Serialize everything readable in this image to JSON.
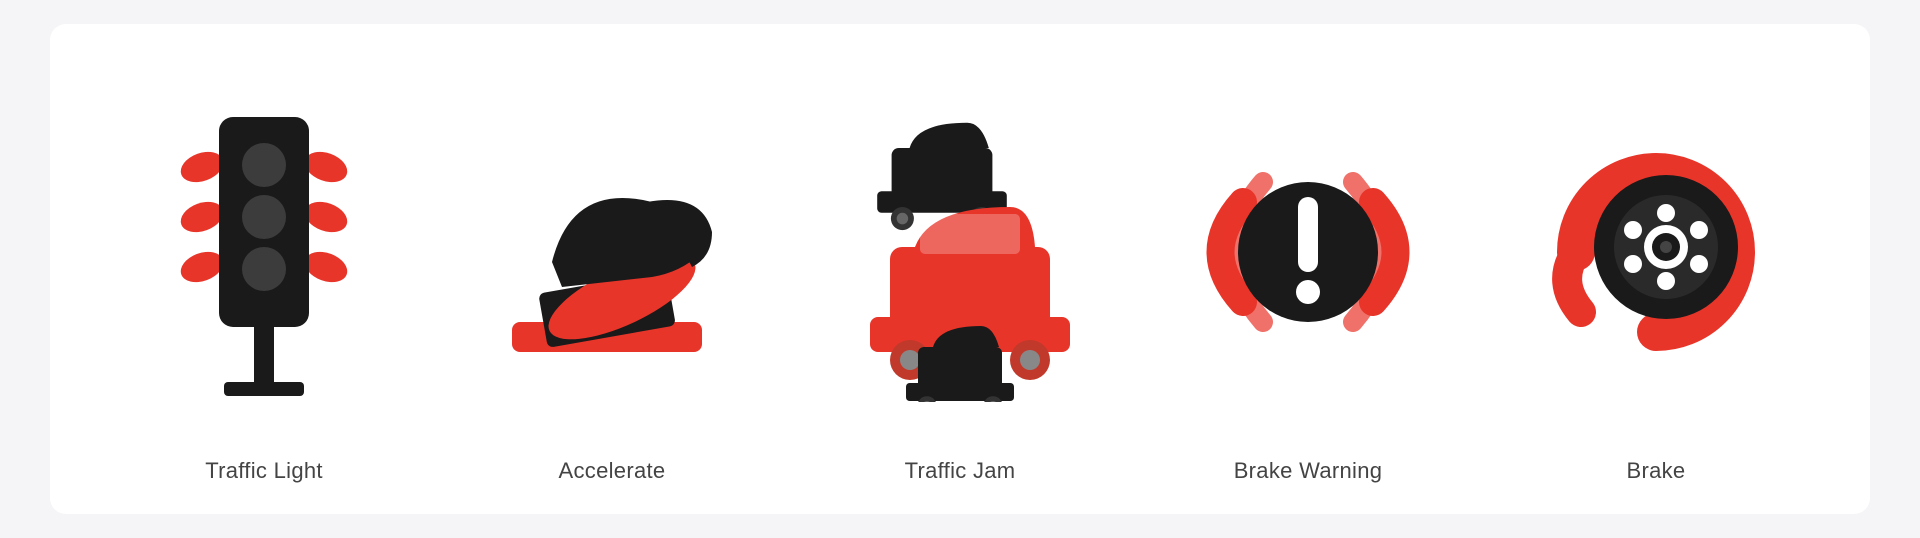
{
  "icons": [
    {
      "id": "traffic-light",
      "label": "Traffic Light"
    },
    {
      "id": "accelerate",
      "label": "Accelerate"
    },
    {
      "id": "traffic-jam",
      "label": "Traffic Jam"
    },
    {
      "id": "brake-warning",
      "label": "Brake Warning"
    },
    {
      "id": "brake",
      "label": "Brake"
    }
  ],
  "background": "#f5f5f7",
  "card_background": "#ffffff"
}
